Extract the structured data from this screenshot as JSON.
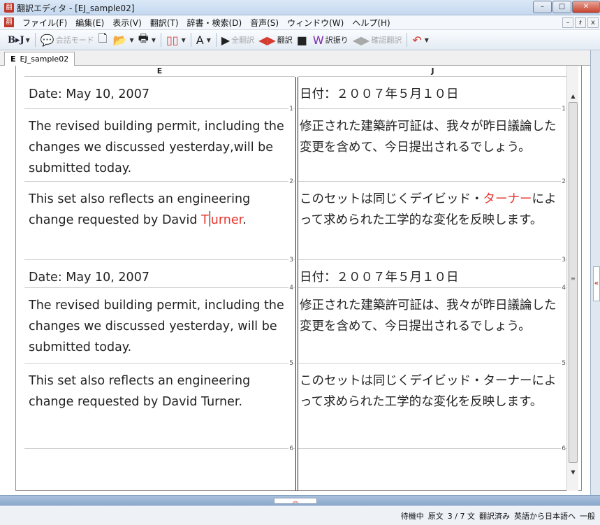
{
  "window": {
    "title": "翻訳エディタ - [EJ_sample02]",
    "app_icon": "翻",
    "minimize": "–",
    "maximize": "□",
    "close": "✕"
  },
  "menubar": {
    "icon": "翻",
    "items": [
      "ファイル(F)",
      "編集(E)",
      "表示(V)",
      "翻訳(T)",
      "辞書・検索(D)",
      "音声(S)",
      "ウィンドウ(W)",
      "ヘルプ(H)"
    ],
    "mdi_min": "–",
    "mdi_restore": "ｫ",
    "mdi_close": "x"
  },
  "toolbar": {
    "bj_label": "B▸J",
    "conversation_mode": "会話モード",
    "translate_all": "全翻訳",
    "translate": "翻訳",
    "reassign": "訳振り",
    "confirm_translate": "確認翻訳"
  },
  "tab": {
    "prefix": "E",
    "name": "EJ_sample02"
  },
  "columns": {
    "source_header": "E",
    "target_header": "J"
  },
  "segments": {
    "source": [
      "Date: May 10, 2007",
      "The revised building permit, including the changes we discussed yesterday,will be submitted today.",
      "This set also reflects an engineering change requested by David ",
      "Date: May 10, 2007",
      "The revised building permit, including the changes we discussed yesterday, will be submitted today.",
      "This set also reflects an engineering change requested by David Turner."
    ],
    "source_3_highlight_a": "T",
    "source_3_highlight_b": "urner",
    "source_3_tail": ".",
    "target": [
      "日付：２００７年５月１０日",
      "修正された建築許可証は、我々が昨日議論した変更を含めて、今日提出されるでしょう。",
      "このセットは同じくデイビッド・",
      "日付：２００７年５月１０日",
      "修正された建築許可証は、我々が昨日議論した変更を含めて、今日提出されるでしょう。",
      "このセットは同じくデイビッド・ターナーによって求められた工学的な変化を反映します。"
    ],
    "target_3_highlight": "ターナー",
    "target_3_tail": "によって求められた工学的な変化を反映します。",
    "numbers": [
      "1",
      "2",
      "3",
      "4",
      "5",
      "6"
    ]
  },
  "statusbar": {
    "state": "待機中",
    "view": "原文",
    "position": "3 / 7 文",
    "translated": "翻訳済み",
    "direction": "英語から日本語へ",
    "field": "一般"
  },
  "colors": {
    "highlight": "#e8362d"
  }
}
